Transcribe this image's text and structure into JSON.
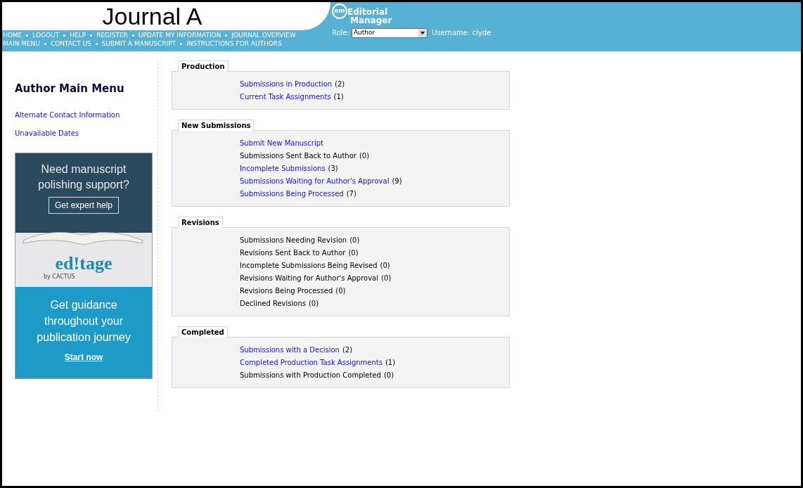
{
  "header": {
    "journal_title": "Journal A",
    "logo": {
      "badge": "em",
      "line1": "Editorial",
      "line2": "Manager"
    },
    "nav_rows": [
      [
        "HOME",
        "LOGOUT",
        "HELP",
        "REGISTER",
        "UPDATE MY INFORMATION",
        "JOURNAL OVERVIEW"
      ],
      [
        "MAIN MENU",
        "CONTACT US",
        "SUBMIT A MANUSCRIPT",
        "INSTRUCTIONS FOR AUTHORS"
      ]
    ],
    "role_label": "Role:",
    "role_value": "Author",
    "username": "Username: clyde"
  },
  "sidebar": {
    "title": "Author Main Menu",
    "links": [
      "Alternate Contact Information",
      "Unavailable Dates"
    ]
  },
  "ad": {
    "headline": "Need manuscript polishing support?",
    "button": "Get expert help",
    "brand": "ed!tage",
    "brand_sub": "by CACTUS",
    "tagline": "Get guidance throughout your publication journey",
    "cta": "Start now"
  },
  "sections": [
    {
      "title": "Production",
      "items": [
        {
          "label": "Submissions in Production",
          "count": "(2)",
          "link": true
        },
        {
          "label": "Current Task Assignments",
          "count": "(1)",
          "link": true
        }
      ]
    },
    {
      "title": "New Submissions",
      "items": [
        {
          "label": "Submit New Manuscript",
          "link": true
        },
        {
          "label": "Submissions Sent Back to Author",
          "count": "(0)",
          "link": false
        },
        {
          "label": "Incomplete Submissions",
          "count": "(3)",
          "link": true
        },
        {
          "label": "Submissions Waiting for Author's Approval",
          "count": "(9)",
          "link": true
        },
        {
          "label": "Submissions Being Processed",
          "count": "(7)",
          "link": true
        }
      ]
    },
    {
      "title": "Revisions",
      "items": [
        {
          "label": "Submissions Needing Revision",
          "count": "(0)",
          "link": false
        },
        {
          "label": "Revisions Sent Back to Author",
          "count": "(0)",
          "link": false
        },
        {
          "label": "Incomplete Submissions Being Revised",
          "count": "(0)",
          "link": false
        },
        {
          "label": "Revisions Waiting for Author's Approval",
          "count": "(0)",
          "link": false
        },
        {
          "label": "Revisions Being Processed",
          "count": "(0)",
          "link": false
        },
        {
          "label": "Declined Revisions",
          "count": "(0)",
          "link": false
        }
      ]
    },
    {
      "title": "Completed",
      "items": [
        {
          "label": "Submissions with a Decision",
          "count": "(2)",
          "link": true
        },
        {
          "label": "Completed Production Task Assignments",
          "count": "(1)",
          "link": true
        },
        {
          "label": "Submissions with Production Completed",
          "count": "(0)",
          "link": false
        }
      ]
    }
  ]
}
